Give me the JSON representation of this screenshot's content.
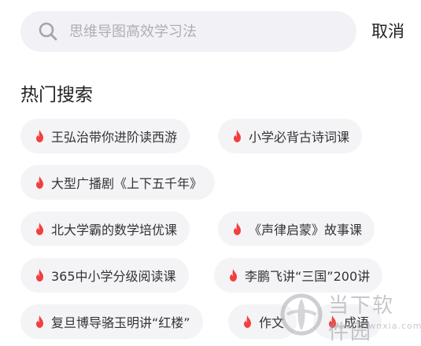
{
  "search": {
    "placeholder": "思维导图高效学习法",
    "value": "",
    "cancel_label": "取消"
  },
  "hot_search": {
    "title": "热门搜索",
    "tags": [
      {
        "label": "王弘治带你进阶读西游"
      },
      {
        "label": "小学必背古诗词课"
      },
      {
        "label": "大型广播剧《上下五千年》"
      },
      {
        "label": "北大学霸的数学培优课"
      },
      {
        "label": "《声律启蒙》故事课"
      },
      {
        "label": "365中小学分级阅读课"
      },
      {
        "label": "李鹏飞讲“三国”200讲"
      },
      {
        "label": "复旦博导骆玉明讲“红楼”"
      },
      {
        "label": "作文"
      },
      {
        "label": "成语"
      }
    ]
  },
  "watermark": {
    "title": "当下软件园",
    "subtitle": "www.downxia.com"
  },
  "colors": {
    "fire": "#f2403f",
    "tag_background": "#f4f4f7",
    "search_background": "#f2f2f6",
    "placeholder": "#adadb8"
  },
  "icons": {
    "search": "search-icon",
    "hot": "fire-icon"
  }
}
